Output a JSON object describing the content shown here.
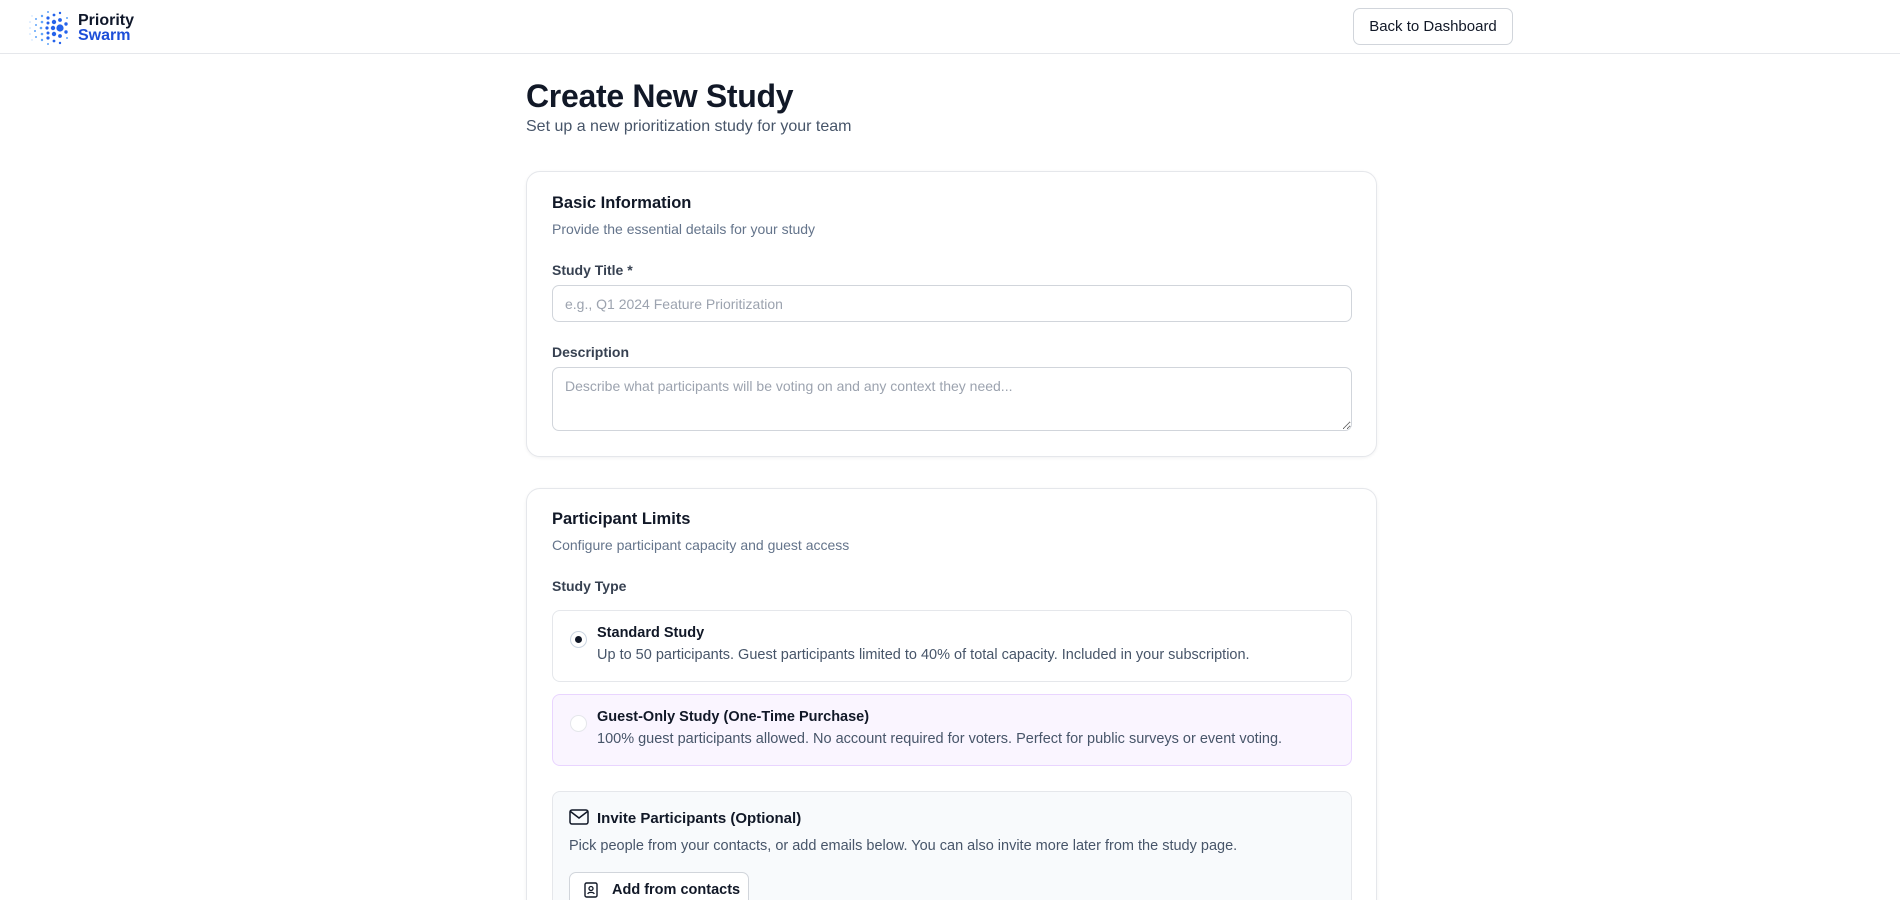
{
  "header": {
    "logo_line1": "Priority",
    "logo_line2": "Swarm",
    "back_label": "Back to Dashboard"
  },
  "page": {
    "title": "Create New Study",
    "subtitle": "Set up a new prioritization study for your team"
  },
  "basic_info": {
    "title": "Basic Information",
    "subtitle": "Provide the essential details for your study",
    "study_title_label": "Study Title *",
    "study_title_value": "",
    "study_title_placeholder": "e.g., Q1 2024 Feature Prioritization",
    "description_label": "Description",
    "description_value": "",
    "description_placeholder": "Describe what participants will be voting on and any context they need..."
  },
  "participant_limits": {
    "title": "Participant Limits",
    "subtitle": "Configure participant capacity and guest access",
    "study_type_label": "Study Type",
    "options": [
      {
        "title": "Standard Study",
        "description": "Up to 50 participants. Guest participants limited to 40% of total capacity. Included in your subscription.",
        "selected": true
      },
      {
        "title": "Guest-Only Study (One-Time Purchase)",
        "description": "100% guest participants allowed. No account required for voters. Perfect for public surveys or event voting.",
        "selected": false
      }
    ],
    "invite": {
      "title": "Invite Participants (Optional)",
      "description": "Pick people from your contacts, or add emails below. You can also invite more later from the study page.",
      "add_contacts_label": "Add from contacts"
    }
  },
  "icons": {
    "logo": "swarm-dots-logo",
    "invite": "mail-icon",
    "contacts": "contact-book-icon"
  },
  "colors": {
    "brand_blue": "#1d4ed8",
    "guest_option_bg": "#faf5ff",
    "guest_option_border": "#e9d5ff",
    "text_dark": "#111827",
    "text_muted": "#64748b"
  }
}
